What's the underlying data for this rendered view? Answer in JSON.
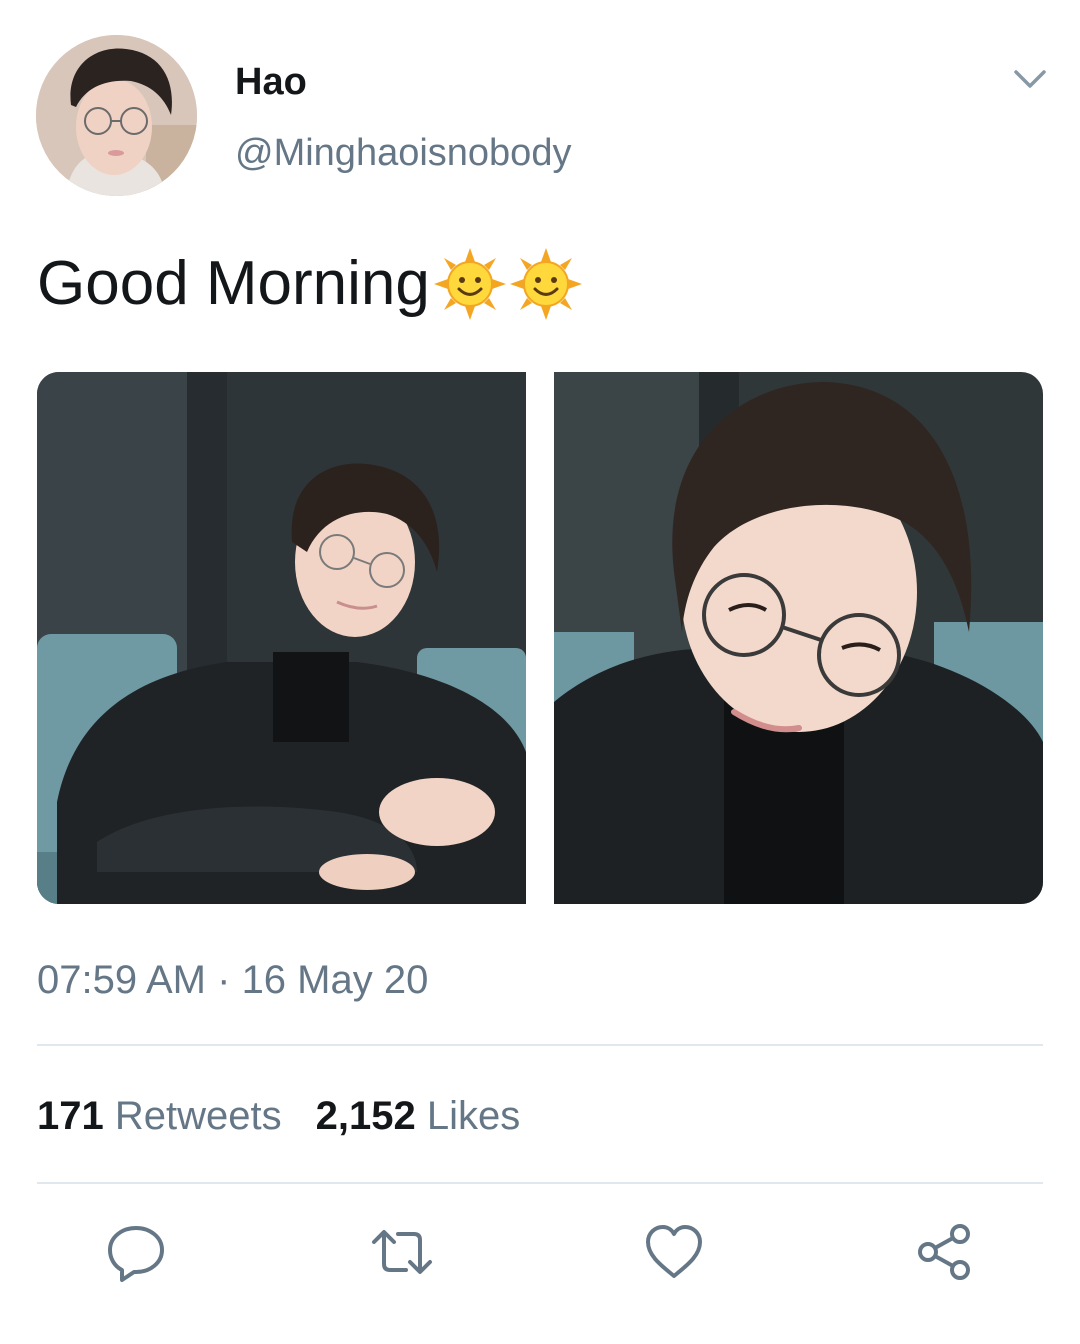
{
  "tweet": {
    "author": {
      "display_name": "Hao",
      "handle": "@Minghaoisnobody",
      "avatar": "avatar"
    },
    "text": "Good Morning",
    "emoji": [
      "sun-with-face-icon",
      "sun-with-face-icon"
    ],
    "media": [
      {
        "description": "photo",
        "kind": "image"
      },
      {
        "description": "photo",
        "kind": "image"
      }
    ],
    "time": "07:59 AM",
    "separator": " · ",
    "date": "16 May 20",
    "stats": {
      "retweets_count": "171",
      "retweets_label": "Retweets",
      "likes_count": "2,152",
      "likes_label": "Likes"
    },
    "actions": [
      "reply-icon",
      "retweet-icon",
      "like-icon",
      "share-icon"
    ]
  },
  "colors": {
    "text_primary": "#14171a",
    "text_secondary": "#657786",
    "divider": "#e1e8ed",
    "icon": "#657786"
  }
}
